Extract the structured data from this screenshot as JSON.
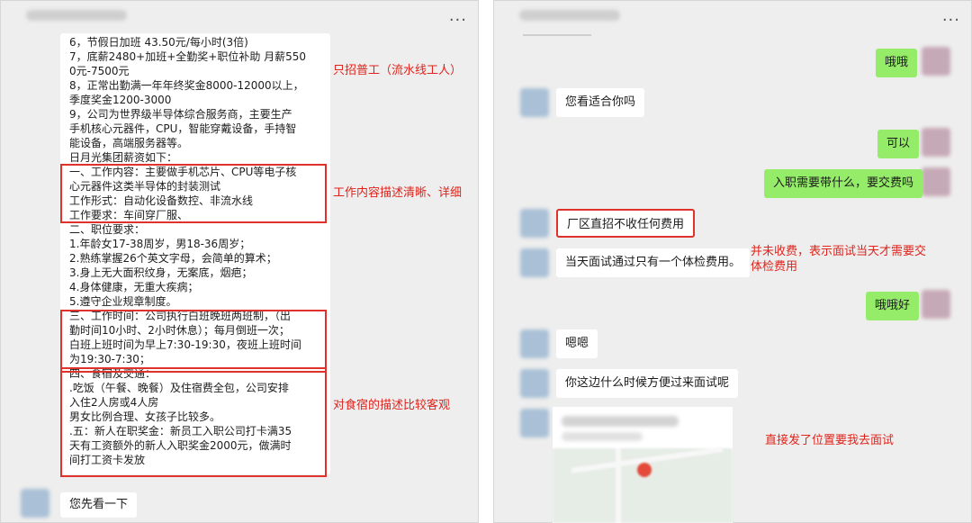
{
  "left": {
    "title": "",
    "more_label": "...",
    "job_lines": [
      "6，节假日加班 43.50元/每小时(3倍)",
      "7，底薪2480+加班+全勤奖+职位补助 月薪550",
      "0元-7500元",
      "8，正常出勤满一年年终奖金8000-12000以上，",
      "季度奖金1200-3000",
      "9，公司为世界级半导体综合服务商，主要生产",
      "手机核心元器件，CPU，智能穿戴设备，手持智",
      "能设备，高端服务器等。",
      "日月光集团薪资如下：",
      "一、工作内容：主要做手机芯片、CPU等电子核",
      "心元器件这类半导体的封装测试",
      "工作形式：自动化设备数控、非流水线",
      "工作要求：车间穿厂服、",
      "二、职位要求：",
      "1.年龄女17-38周岁，男18-36周岁；",
      "2.熟练掌握26个英文字母，会简单的算术；",
      "3.身上无大面积纹身，无案底，烟疤；",
      "4.身体健康，无重大疾病；",
      "5.遵守企业规章制度。",
      "三、工作时间：公司执行白班晚班两班制，（出",
      "勤时间10小时、2小时休息）；每月倒班一次；",
      "白班上班时间为早上7:30-19:30，夜班上班时间",
      "为19:30-7:30；",
      "四、食宿及交通：",
      ".吃饭（午餐、晚餐）及住宿费全包，公司安排",
      "入住2人房或4人房",
      "男女比例合理、女孩子比较多。",
      ".五：新人在职奖金：新员工入职公司打卡满35",
      "天有工资额外的新人入职奖金2000元，做满时",
      "间打工资卡发放"
    ],
    "reply": "您先看一下",
    "annotations": {
      "workers_only": "只招普工（流水线工人）",
      "content_detail": "工作内容描述清晰、详细",
      "food_housing": "对食宿的描述比较客观"
    }
  },
  "right": {
    "title": "",
    "more_label": "...",
    "messages": [
      {
        "side": "me",
        "text": "哦哦"
      },
      {
        "side": "other",
        "text": "您看适合你吗"
      },
      {
        "side": "me",
        "text": "可以"
      },
      {
        "side": "me",
        "text": "入职需要带什么，要交费吗"
      },
      {
        "side": "other",
        "text": "厂区直招不收任何费用"
      },
      {
        "side": "other",
        "text": "当天面试通过只有一个体检费用。"
      },
      {
        "side": "me",
        "text": "哦哦好"
      },
      {
        "side": "other",
        "text": "嗯嗯"
      },
      {
        "side": "other",
        "text": "你这边什么时候方便过来面试呢"
      }
    ],
    "annotations": {
      "no_fee_line1": "并未收费，表示面试当天才需要交",
      "no_fee_line2": "体检费用",
      "location": "直接发了位置要我去面试"
    }
  },
  "colors": {
    "panel_bg": "#eeeeee",
    "my_bubble": "#95ec69",
    "other_bubble": "#ffffff",
    "annotation_red": "#e0231b"
  }
}
